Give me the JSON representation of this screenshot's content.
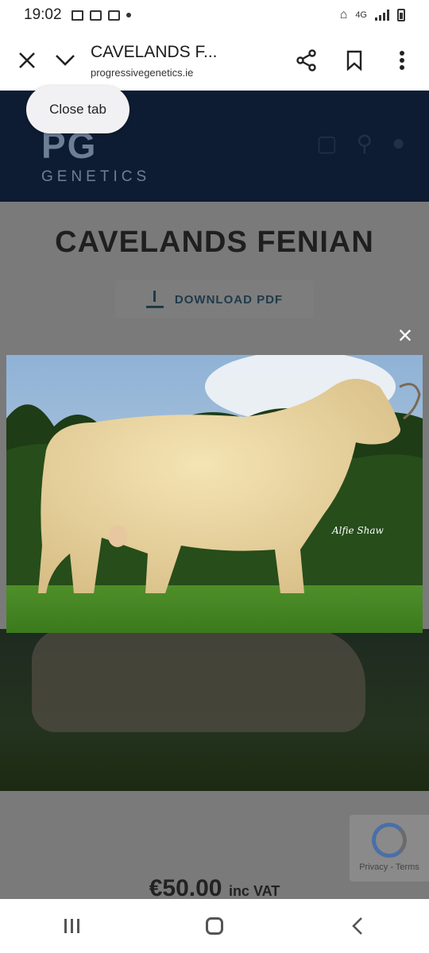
{
  "status_bar": {
    "time": "19:02",
    "network": "4G"
  },
  "toolbar": {
    "title": "CAVELANDS F...",
    "url": "progressivegenetics.ie",
    "close_icon": "close-icon",
    "collapse_icon": "chevron-down-icon",
    "share_icon": "share-icon",
    "bookmark_icon": "bookmark-icon",
    "menu_icon": "more-vertical-icon"
  },
  "tooltip": {
    "label": "Close tab"
  },
  "site": {
    "logo_mark": "PG",
    "logo_text": "GENETICS",
    "cart_icon": "bag-icon",
    "search_icon": "search-icon",
    "user_icon": "user-icon"
  },
  "product": {
    "title": "CAVELANDS FENIAN",
    "download_label": "DOWNLOAD PDF",
    "price": "€50.00",
    "price_suffix": "inc VAT",
    "photo_watermark": "Alfie Shaw"
  },
  "recaptcha": {
    "links": "Privacy - Terms"
  },
  "lightbox": {
    "close_label": "×"
  },
  "colors": {
    "header_bg": "#0d1c33",
    "overlay": "#7a7a7a",
    "accent": "#1f3a4a"
  }
}
